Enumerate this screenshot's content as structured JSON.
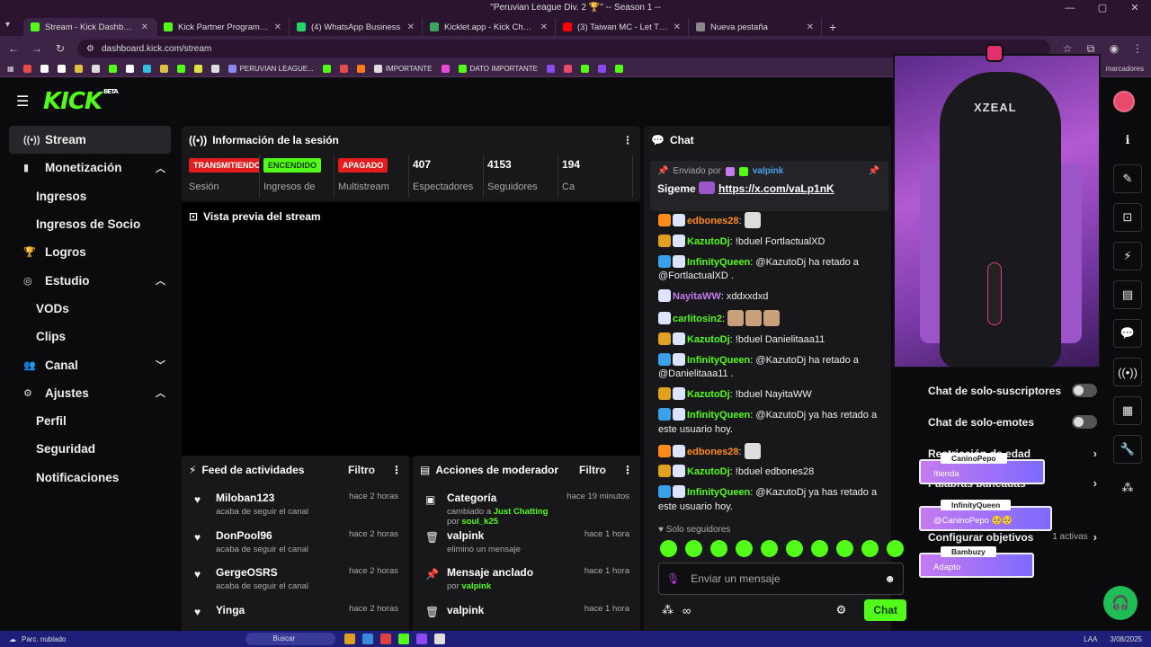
{
  "window": {
    "title": "\"Peruvian League Div. 2 🏆\" -- Season 1 --"
  },
  "tabs": [
    {
      "label": "Stream - Kick Dashboard",
      "color": "#53fc18",
      "active": true
    },
    {
      "label": "Kick Partner Program - Kick Da",
      "color": "#53fc18"
    },
    {
      "label": "(4) WhatsApp Business",
      "color": "#25d366"
    },
    {
      "label": "Kicklet.app - Kick Chatbot and",
      "color": "#3aa55d"
    },
    {
      "label": "(3) Taiwan MC - Let The Weed",
      "color": "#ff0000"
    },
    {
      "label": "Nueva pestaña",
      "color": "#888888"
    }
  ],
  "address": {
    "url": "dashboard.kick.com/stream"
  },
  "bookmarks": [
    {
      "label": "PERUVIAN LEAGUE...",
      "color": "#8a8af0"
    },
    {
      "label": "IMPORTANTE",
      "color": "#dddddd"
    },
    {
      "label": "DATO IMPORTANTE",
      "color": "#53fc18"
    }
  ],
  "bookmarks_all": "marcadores",
  "header": {
    "logo": "KICK",
    "beta": "BETA"
  },
  "sidebar": [
    {
      "label": "Stream",
      "icon": "broadcast-icon",
      "glyph": "((•))",
      "active": true
    },
    {
      "label": "Monetización",
      "icon": "chart-icon",
      "glyph": "▮",
      "chev": "︿"
    },
    {
      "label": "Ingresos",
      "sub": true
    },
    {
      "label": "Ingresos de Socio",
      "sub": true
    },
    {
      "label": "Logros",
      "icon": "trophy-icon",
      "glyph": "🏆"
    },
    {
      "label": "Estudio",
      "icon": "studio-icon",
      "glyph": "◎",
      "chev": "︿"
    },
    {
      "label": "VODs",
      "sub": true
    },
    {
      "label": "Clips",
      "sub": true
    },
    {
      "label": "Canal",
      "icon": "users-icon",
      "glyph": "👥",
      "chev": "﹀"
    },
    {
      "label": "Ajustes",
      "icon": "gear-icon",
      "glyph": "⚙",
      "chev": "︿"
    },
    {
      "label": "Perfil",
      "sub": true
    },
    {
      "label": "Seguridad",
      "sub": true
    },
    {
      "label": "Notificaciones",
      "sub": true
    }
  ],
  "session": {
    "title": "Información de la sesión",
    "stats": [
      {
        "badge": "TRANSMITIENDO",
        "badge_color": "red",
        "label": "Sesión"
      },
      {
        "badge": "ENCENDIDO",
        "badge_color": "green",
        "label": "Ingresos de"
      },
      {
        "badge": "APAGADO",
        "badge_color": "red",
        "label": "Multistream"
      },
      {
        "value": "407",
        "label": "Espectadores"
      },
      {
        "value": "4153",
        "label": "Seguidores"
      },
      {
        "value": "194",
        "label": "Ca"
      }
    ]
  },
  "preview": {
    "title": "Vista previa del stream"
  },
  "feed": {
    "title": "Feed de actividades",
    "filter": "Filtro",
    "items": [
      {
        "name": "Miloban123",
        "desc": "acaba de seguir el canal",
        "time": "hace 2 horas"
      },
      {
        "name": "DonPool96",
        "desc": "acaba de seguir el canal",
        "time": "hace 2 horas"
      },
      {
        "name": "GergeOSRS",
        "desc": "acaba de seguir el canal",
        "time": "hace 2 horas"
      },
      {
        "name": "Yinga",
        "desc": "",
        "time": "hace 2 horas"
      }
    ]
  },
  "modactions": {
    "title": "Acciones de moderador",
    "filter": "Filtro",
    "items": [
      {
        "icon": "category-icon",
        "glyph": "▣",
        "name": "Categoría",
        "desc_a": "cambiado a ",
        "desc_hl": "Just Chatting",
        "desc_b": " por ",
        "desc_hl2": "soul_k25",
        "time": "hace 19 minutos"
      },
      {
        "icon": "trash-icon",
        "glyph": "🗑",
        "name": "valpink",
        "desc_a": "eliminó un mensaje",
        "time": "hace 1 hora"
      },
      {
        "icon": "pin-icon",
        "glyph": "📌",
        "name": "Mensaje anclado",
        "desc_a": "por ",
        "desc_hl": "valpink",
        "time": "hace 1 hora"
      },
      {
        "icon": "trash-icon",
        "glyph": "🗑",
        "name": "valpink",
        "desc_a": "",
        "time": "hace 1 hora"
      }
    ]
  },
  "chat": {
    "title": "Chat",
    "pinned": {
      "sent_by": "Enviado por",
      "user": "valpink",
      "text": "Sigeme",
      "link": "https://x.com/vaLp1nK"
    },
    "messages": [
      {
        "user": "edbones28",
        "color": "#ff8c1a",
        "text": "",
        "emotes": 0
      },
      {
        "user": "KazutoDj",
        "color": "#53fc18",
        "text": "!bduel FortlactualXD"
      },
      {
        "user": "InfinityQueen",
        "color": "#53fc18",
        "text": "@KazutoDj ha retado a @FortlactualXD ."
      },
      {
        "user": "NayitaWW",
        "color": "#c57aef",
        "text": "xddxxdxd"
      },
      {
        "user": "carlitosin2",
        "color": "#53fc18",
        "text": "",
        "emotes": 3
      },
      {
        "user": "KazutoDj",
        "color": "#53fc18",
        "text": "!bduel Danielitaaa11"
      },
      {
        "user": "InfinityQueen",
        "color": "#53fc18",
        "text": "@KazutoDj ha retado a @Danielitaaa11 ."
      },
      {
        "user": "KazutoDj",
        "color": "#53fc18",
        "text": "!bduel NayitaWW"
      },
      {
        "user": "InfinityQueen",
        "color": "#53fc18",
        "text": "@KazutoDj ya has retado a este usuario hoy."
      },
      {
        "user": "edbones28",
        "color": "#ff8c1a",
        "text": "",
        "emotes": 0
      },
      {
        "user": "KazutoDj",
        "color": "#53fc18",
        "text": "!bduel edbones28"
      },
      {
        "user": "InfinityQueen",
        "color": "#53fc18",
        "text": "@KazutoDj ya has retado a este usuario hoy."
      }
    ],
    "followers_only": "Solo seguidores",
    "placeholder": "Enviar un mensaje",
    "send": "Chat"
  },
  "settings": {
    "subs_only": "Chat de solo-suscriptores",
    "emotes_only": "Chat de solo-emotes",
    "age": "Restricción de edad",
    "banned": "Palabras baneadas",
    "goals": "Configurar objetivos",
    "goals_extra": "1 activas"
  },
  "alerts": [
    {
      "user": "CaninoPepo",
      "text": "!tienda"
    },
    {
      "user": "InfinityQueen",
      "text": "@CaninoPepo 🥺🥺"
    },
    {
      "user": "Bambuzy",
      "text": "Adapto"
    }
  ],
  "webcam": {
    "brand": "XZEAL"
  },
  "rightbar": [
    {
      "icon": "info-icon",
      "glyph": "ℹ",
      "plain": true
    },
    {
      "icon": "edit-icon",
      "glyph": "✎"
    },
    {
      "icon": "camera-icon",
      "glyph": "⊡"
    },
    {
      "icon": "bolt-icon",
      "glyph": "⚡"
    },
    {
      "icon": "document-icon",
      "glyph": "▤"
    },
    {
      "icon": "chat-bubble-icon",
      "glyph": "💬"
    },
    {
      "icon": "broadcast-icon",
      "glyph": "((•))"
    },
    {
      "icon": "layout-icon",
      "glyph": "▦"
    },
    {
      "icon": "wrench-icon",
      "glyph": "🔧"
    },
    {
      "icon": "apps-icon",
      "glyph": "⁂",
      "plain": true
    }
  ],
  "taskbar": {
    "weather": "Parc. nublado",
    "search": "Buscar",
    "lang": "LAA",
    "date": "3/08/2025"
  }
}
